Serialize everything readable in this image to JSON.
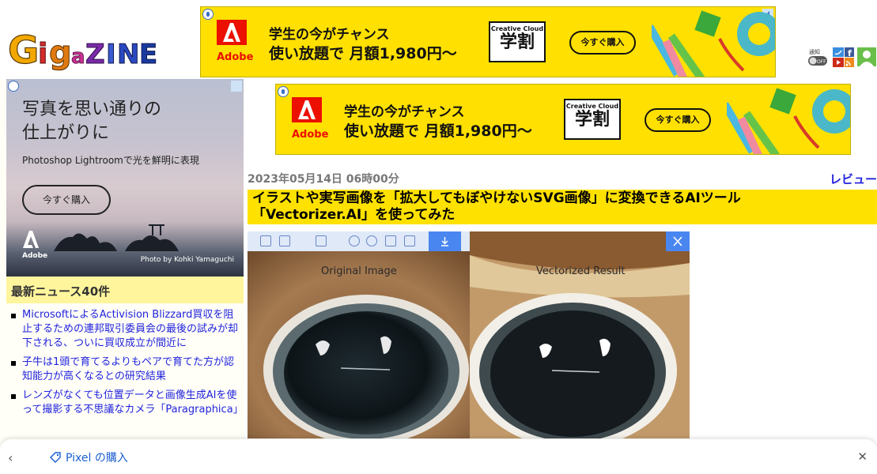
{
  "site": {
    "logo_text": "GigaZINE"
  },
  "header_ad": {
    "brand": "Adobe",
    "line1": "学生の今がチャンス",
    "line2": "使い放題で 月額1,980円〜",
    "badge_top": "Creative Cloud",
    "badge_main": "学割",
    "cta": "今すぐ購入"
  },
  "header_icons": [
    "notification-toggle-icon",
    "twitter-icon",
    "facebook-icon",
    "youtube-icon",
    "rss-icon",
    "user-icon"
  ],
  "header_icons_text": {
    "notify": "通知",
    "toggle": "OFF"
  },
  "sidebar_ad": {
    "headline_line1": "写真を思い通りの",
    "headline_line2": "仕上がりに",
    "sub": "Photoshop Lightroomで光を鮮明に表現",
    "cta": "今すぐ購入",
    "brand": "Adobe",
    "credit": "Photo by Kohki Yamaguchi"
  },
  "news": {
    "heading": "最新ニュース40件",
    "items": [
      "MicrosoftによるActivision Blizzard買収を阻止するための連邦取引委員会の最後の試みが却下される、ついに買収成立が間近に",
      "子牛は1頭で育てるよりもペアで育てた方が認知能力が高くなるとの研究結果",
      "レンズがなくても位置データと画像生成AIを使って撮影する不思議なカメラ「Paragraphica」"
    ]
  },
  "main_ad": {
    "brand": "Adobe",
    "line1": "学生の今がチャンス",
    "line2": "使い放題で 月額1,980円〜",
    "badge_top": "Creative Cloud",
    "badge_main": "学割",
    "cta": "今すぐ購入"
  },
  "article": {
    "date": "2023年05月14日 06時00分",
    "category": "レビュー",
    "title_line1": "イラストや実写画像を「拡大してもぼやけないSVG画像」に変換できるAIツール",
    "title_line2": "「Vectorizer.AI」を使ってみた",
    "image_left_label": "Original Image",
    "image_right_label": "Vectorized Result"
  },
  "bottom_bar": {
    "label": "Pixel の購入"
  },
  "colors": {
    "accent_yellow": "#ffe100",
    "link_blue": "#2222dd",
    "adobe_red": "#eb1000"
  }
}
